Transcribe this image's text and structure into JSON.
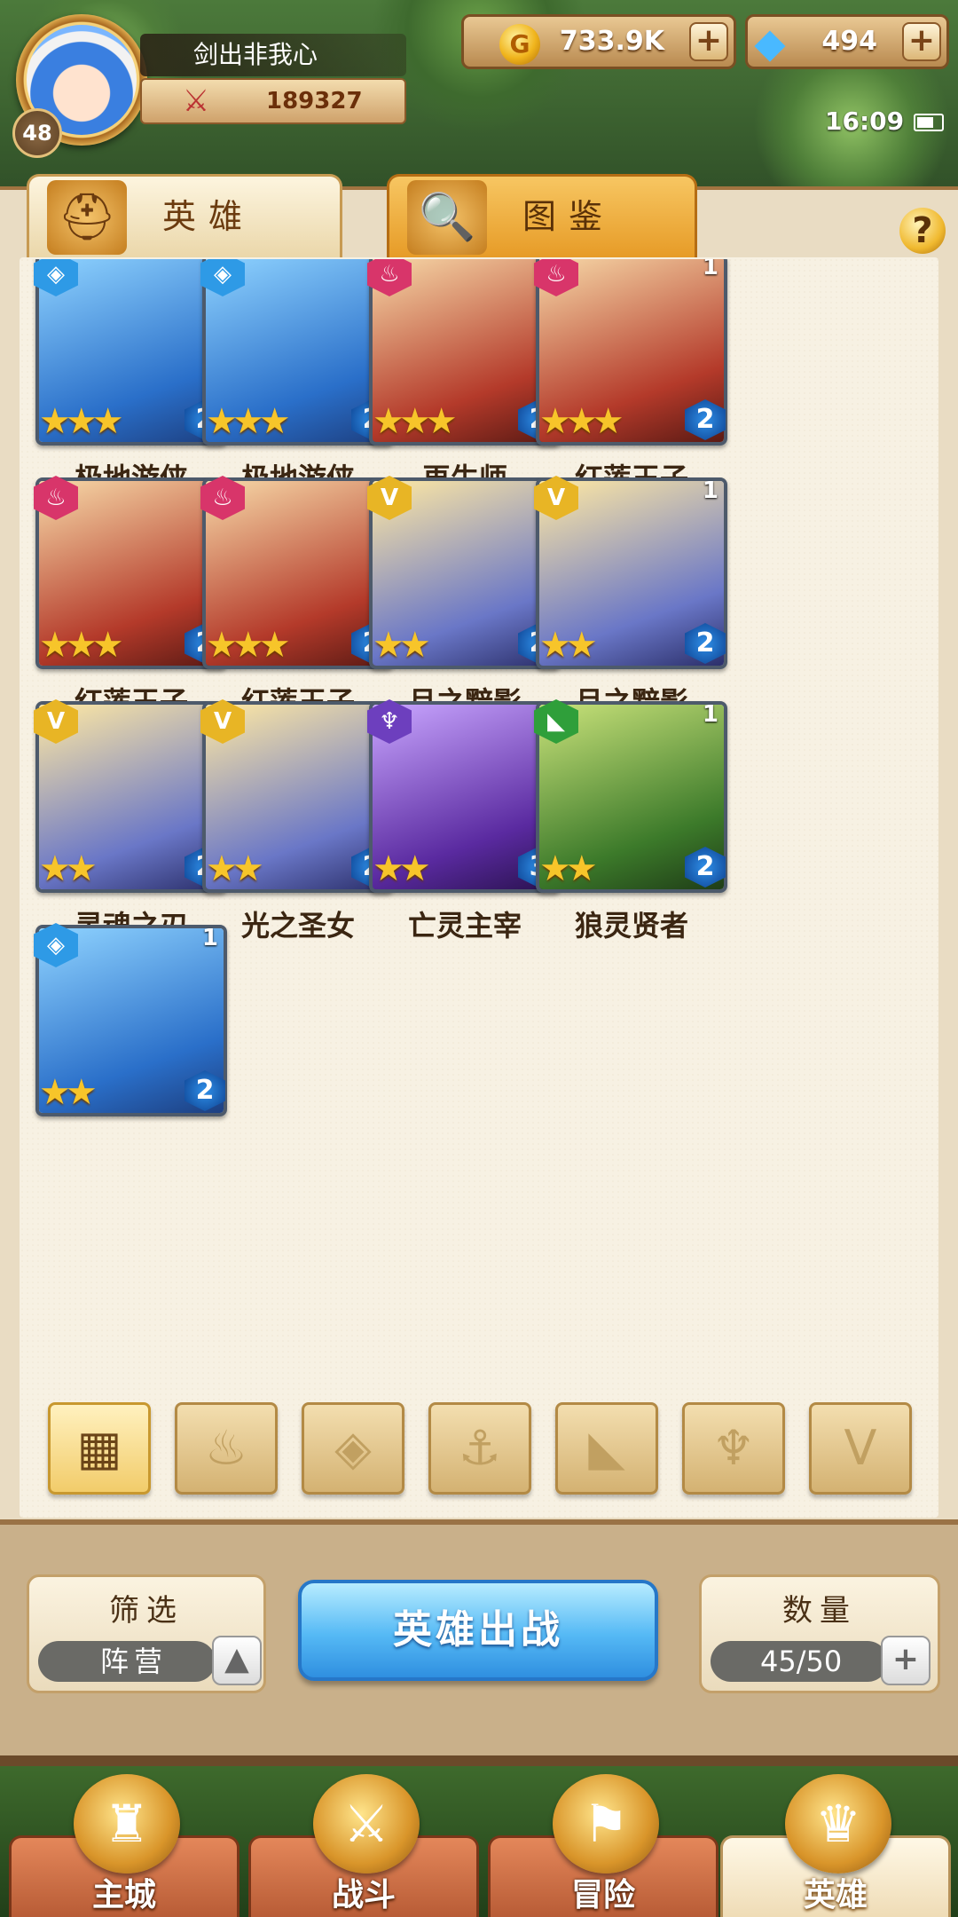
{
  "player": {
    "name": "剑出非我心",
    "level": "48",
    "power": "189327"
  },
  "currency": {
    "gold": "733.9K",
    "gems": "494"
  },
  "status": {
    "time": "16:09"
  },
  "tabs": [
    {
      "label": "英雄",
      "icon": "hero-helmet-icon"
    },
    {
      "label": "图鉴",
      "icon": "magnifier-book-icon"
    }
  ],
  "heroes": [
    {
      "name": "极地游侠",
      "faction": "water",
      "count": "1",
      "stars": 3,
      "rank": "2"
    },
    {
      "name": "极地游侠",
      "faction": "water",
      "count": "1",
      "stars": 3,
      "rank": "2"
    },
    {
      "name": "再生师",
      "faction": "fire",
      "count": "1",
      "stars": 3,
      "rank": "2"
    },
    {
      "name": "红莲王子",
      "faction": "fire",
      "count": "1",
      "stars": 3,
      "rank": "2"
    },
    {
      "name": "红莲王子",
      "faction": "fire",
      "count": "1",
      "stars": 3,
      "rank": "2"
    },
    {
      "name": "红莲王子",
      "faction": "fire",
      "count": "1",
      "stars": 3,
      "rank": "2"
    },
    {
      "name": "月之黯影",
      "faction": "light",
      "count": "1",
      "stars": 2,
      "rank": "2"
    },
    {
      "name": "月之黯影",
      "faction": "light",
      "count": "1",
      "stars": 2,
      "rank": "2"
    },
    {
      "name": "灵魂之刃",
      "faction": "light",
      "count": "1",
      "stars": 2,
      "rank": "2"
    },
    {
      "name": "光之圣女",
      "faction": "light",
      "count": "1",
      "stars": 2,
      "rank": "2"
    },
    {
      "name": "亡灵主宰",
      "faction": "dark",
      "count": "1",
      "stars": 2,
      "rank": "3"
    },
    {
      "name": "狼灵贤者",
      "faction": "nature",
      "count": "1",
      "stars": 2,
      "rank": "2"
    },
    {
      "name": "",
      "faction": "water",
      "count": "1",
      "stars": 2,
      "rank": "2"
    }
  ],
  "filter_icons": [
    "grid-icon",
    "fire-icon",
    "water-icon",
    "anchor-icon",
    "beast-icon",
    "dark-icon",
    "light-icon"
  ],
  "controls": {
    "filter_title": "筛选",
    "filter_value": "阵营",
    "deploy_label": "英雄出战",
    "count_title": "数量",
    "count_value": "45/50"
  },
  "nav": [
    {
      "label": "主城",
      "icon": "castle-icon"
    },
    {
      "label": "战斗",
      "icon": "crossed-swords-icon"
    },
    {
      "label": "冒险",
      "icon": "map-scroll-icon"
    },
    {
      "label": "英雄",
      "icon": "hero-helmet-icon"
    }
  ],
  "colors": {
    "water": "#2e9ae6",
    "fire": "#d8356a",
    "light": "#e8b525",
    "dark": "#6d3fbe",
    "nature": "#2f9f3a"
  }
}
